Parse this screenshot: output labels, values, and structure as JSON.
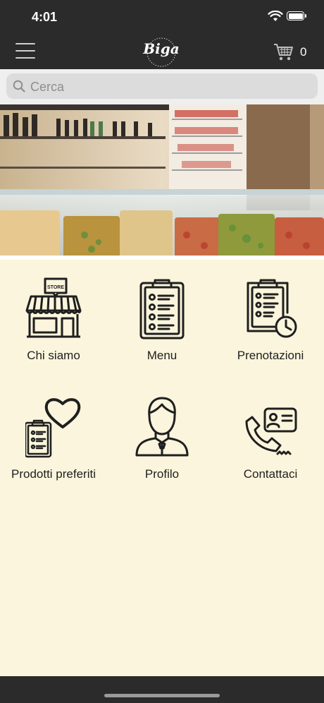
{
  "status_bar": {
    "time": "4:01"
  },
  "nav": {
    "logo_text": "Biga",
    "cart_count": "0"
  },
  "search": {
    "placeholder": "Cerca"
  },
  "tiles": [
    {
      "label": "Chi siamo",
      "icon": "store-icon",
      "store_sign": "STORE"
    },
    {
      "label": "Menu",
      "icon": "clipboard-list-icon"
    },
    {
      "label": "Prenotazioni",
      "icon": "clipboard-clock-icon"
    },
    {
      "label": "Prodotti preferiti",
      "icon": "clipboard-heart-icon"
    },
    {
      "label": "Profilo",
      "icon": "user-profile-icon"
    },
    {
      "label": "Contattaci",
      "icon": "phone-contact-icon"
    }
  ],
  "colors": {
    "bars": "#2b2b2b",
    "background": "#faf5dc",
    "icon_stroke": "#1f1f1f"
  }
}
